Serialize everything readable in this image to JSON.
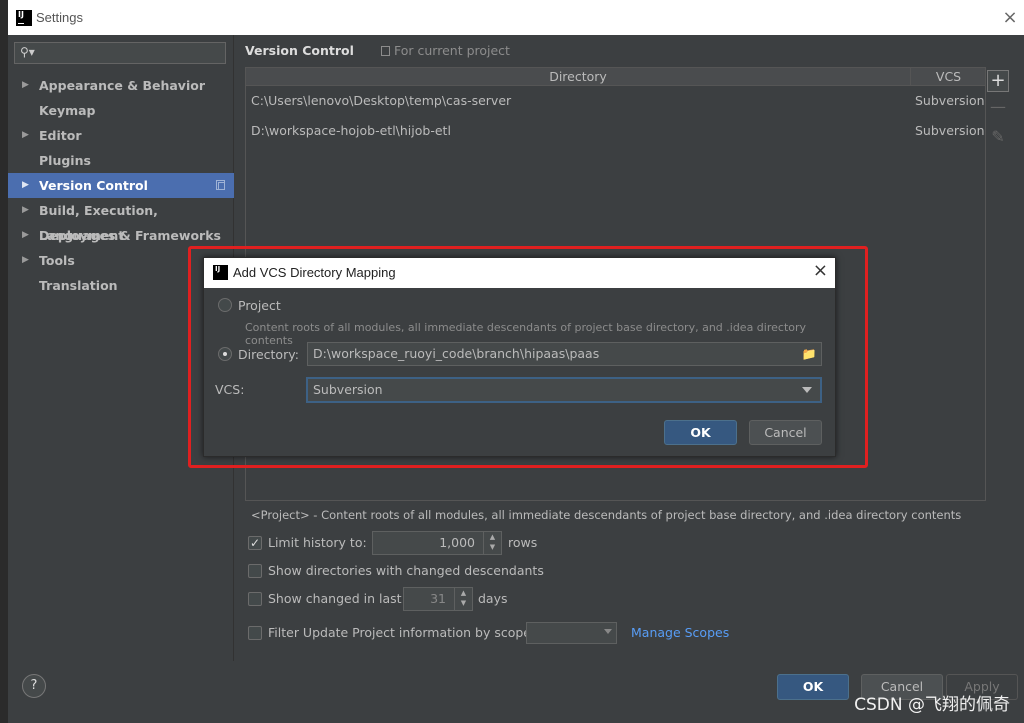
{
  "window": {
    "title": "Settings",
    "close": "×"
  },
  "sidebar": {
    "search_placeholder": "",
    "items": [
      {
        "label": "Appearance & Behavior",
        "expandable": true,
        "selected": false
      },
      {
        "label": "Keymap",
        "expandable": false,
        "selected": false
      },
      {
        "label": "Editor",
        "expandable": true,
        "selected": false
      },
      {
        "label": "Plugins",
        "expandable": false,
        "selected": false
      },
      {
        "label": "Version Control",
        "expandable": true,
        "selected": true
      },
      {
        "label": "Build, Execution, Deployment",
        "expandable": true,
        "selected": false
      },
      {
        "label": "Languages & Frameworks",
        "expandable": true,
        "selected": false
      },
      {
        "label": "Tools",
        "expandable": true,
        "selected": false
      },
      {
        "label": "Translation",
        "expandable": false,
        "selected": false
      }
    ]
  },
  "main": {
    "heading": "Version Control",
    "scope": "For current project",
    "table": {
      "col_directory": "Directory",
      "col_vcs": "VCS",
      "rows": [
        {
          "directory": "C:\\Users\\lenovo\\Desktop\\temp\\cas-server",
          "vcs": "Subversion"
        },
        {
          "directory": "D:\\workspace-hojob-etl\\hijob-etl",
          "vcs": "Subversion"
        }
      ]
    },
    "info": "<Project> - Content roots of all modules, all immediate descendants of project base directory, and .idea directory contents",
    "limit_history": {
      "label": "Limit history to:",
      "checked": true,
      "value": "1,000",
      "suffix": "rows"
    },
    "show_dirs": {
      "label": "Show directories with changed descendants",
      "checked": false
    },
    "show_changed": {
      "label": "Show changed in last",
      "checked": false,
      "value": "31",
      "suffix": "days"
    },
    "filter_update": {
      "label": "Filter Update Project information by scope",
      "checked": false,
      "value": ""
    },
    "manage_scopes": "Manage Scopes"
  },
  "footer": {
    "help": "?",
    "ok": "OK",
    "cancel": "Cancel",
    "apply": "Apply"
  },
  "dialog": {
    "title": "Add VCS Directory Mapping",
    "close": "×",
    "project_label": "Project",
    "project_hint": "Content roots of all modules, all immediate descendants of project base directory, and .idea directory contents",
    "directory_label": "Directory:",
    "directory_value": "D:\\workspace_ruoyi_code\\branch\\hipaas\\paas",
    "vcs_label": "VCS:",
    "vcs_value": "Subversion",
    "ok": "OK",
    "cancel": "Cancel",
    "selected_option": "Directory"
  },
  "watermark": "CSDN @飞翔的佩奇",
  "colors": {
    "selection": "#4b6eaf",
    "primary_button": "#365880",
    "highlight_border": "#e02020",
    "link": "#589df6"
  }
}
